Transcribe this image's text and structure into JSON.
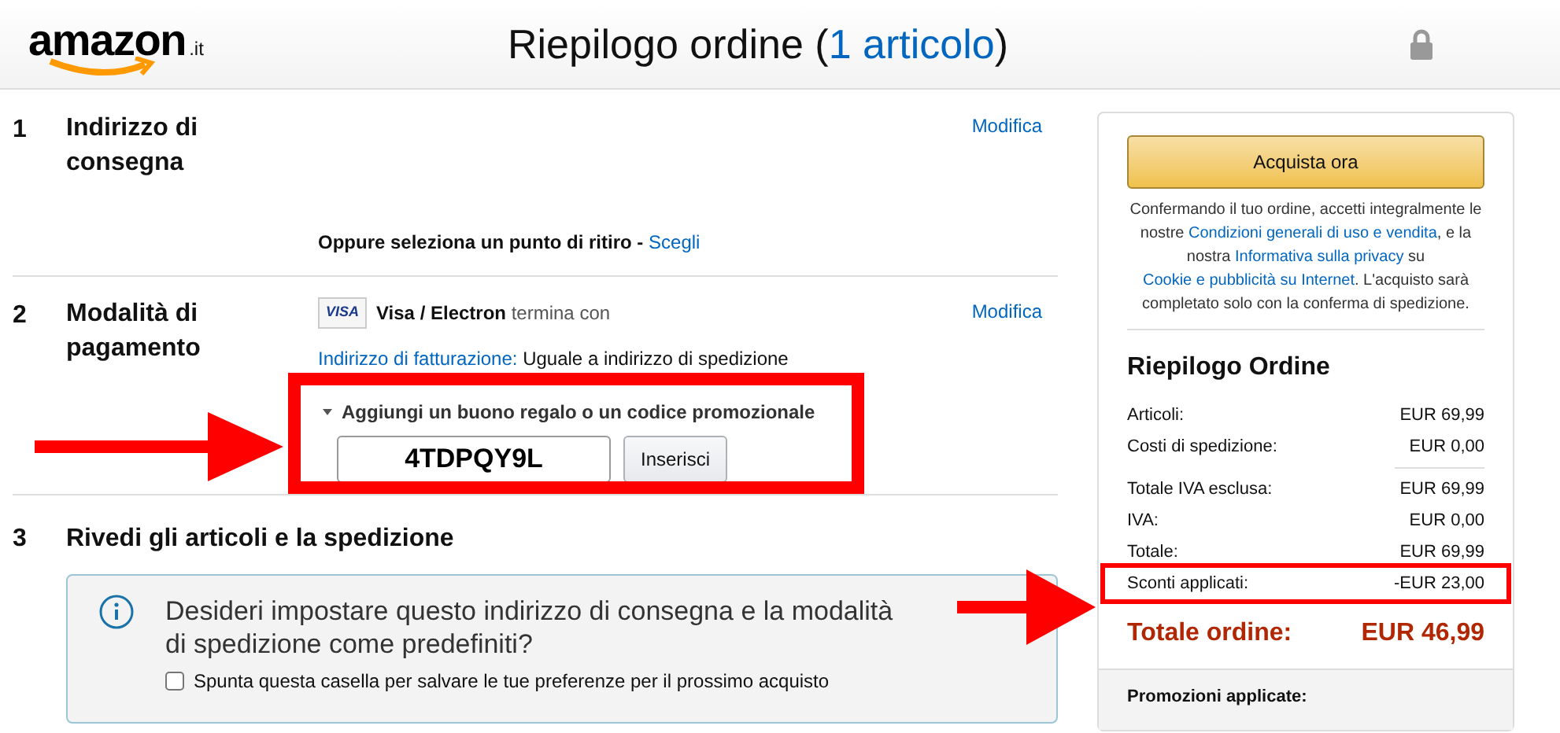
{
  "header": {
    "logo_text": "amazon",
    "logo_suffix": ".it",
    "title": "Riepilogo ordine",
    "title_open": "(",
    "item_count_link": "1 articolo",
    "title_close": ")"
  },
  "sections": [
    {
      "number": "1",
      "title": "Indirizzo di consegna",
      "action": "Modifica",
      "pickup_text": "Oppure seleziona un punto di ritiro -",
      "pickup_link": "Scegli"
    },
    {
      "number": "2",
      "title": "Modalità di pagamento",
      "action": "Modifica",
      "card_badge": "VISA",
      "card_name": "Visa / Electron",
      "card_suffix": "termina con",
      "billing_link": "Indirizzo di fatturazione:",
      "billing_value": "Uguale a indirizzo di spedizione",
      "promo": {
        "label": "Aggiungi un buono regalo o un codice promozionale",
        "expanded": true,
        "code": "4TDPQY9L",
        "button": "Inserisci"
      }
    },
    {
      "number": "3",
      "title": "Rivedi gli articoli e la spedizione",
      "info": {
        "question": "Desideri impostare questo indirizzo di consegna e la modalità di spedizione come predefiniti?",
        "checkbox_label": "Spunta questa casella per salvare le tue preferenze per il prossimo acquisto",
        "checked": false
      }
    }
  ],
  "summary": {
    "buy_button": "Acquista ora",
    "legal": [
      {
        "text": "Confermando il tuo ordine, accetti integralmente le nostre ",
        "link": false
      },
      {
        "text": "Condizioni generali di uso e vendita",
        "link": true
      },
      {
        "text": ", e la nostra ",
        "link": false
      },
      {
        "text": "Informativa sulla privacy",
        "link": true
      },
      {
        "text": " su ",
        "link": false
      },
      {
        "text": "Cookie e pubblicità su Internet",
        "link": true
      },
      {
        "text": ". L'acquisto sarà completato solo con la conferma di spedizione.",
        "link": false
      }
    ],
    "title": "Riepilogo Ordine",
    "rows": [
      {
        "label": "Articoli:",
        "value": "EUR 69,99",
        "divider_after": false,
        "highlighted": false
      },
      {
        "label": "Costi di spedizione:",
        "value": "EUR 0,00",
        "divider_after": true,
        "highlighted": false
      },
      {
        "label": "Totale IVA esclusa:",
        "value": "EUR 69,99",
        "divider_after": false,
        "highlighted": false
      },
      {
        "label": "IVA:",
        "value": "EUR 0,00",
        "divider_after": false,
        "highlighted": false
      },
      {
        "label": "Totale:",
        "value": "EUR 69,99",
        "divider_after": false,
        "highlighted": false
      },
      {
        "label": "Sconti applicati:",
        "value": "-EUR 23,00",
        "divider_after": false,
        "highlighted": true
      }
    ],
    "total_label": "Totale ordine:",
    "total_value": "EUR 46,99",
    "promotions_label": "Promozioni applicate:"
  }
}
